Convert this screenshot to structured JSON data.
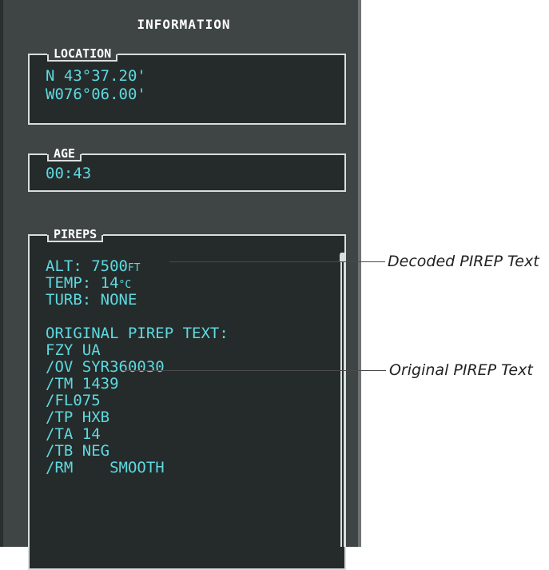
{
  "panel": {
    "title": "INFORMATION"
  },
  "location": {
    "label": "LOCATION",
    "latitude": "N 43°37.20'",
    "longitude": "W076°06.00'"
  },
  "age": {
    "label": "AGE",
    "value": "00:43"
  },
  "pireps": {
    "label": "PIREPS",
    "decoded": {
      "alt_prefix": "ALT: 7500",
      "alt_unit": "FT",
      "temp_prefix": "TEMP: 14",
      "temp_unit": "°C",
      "turb": "TURB: NONE"
    },
    "original_header": "ORIGINAL PIREP TEXT:",
    "original_lines": [
      "FZY UA",
      "/OV SYR360030",
      "/TM 1439",
      "/FL075",
      "/TP HXB",
      "/TA 14",
      "/TB NEG",
      "/RM    SMOOTH"
    ]
  },
  "callouts": {
    "decoded": "Decoded PIREP Text",
    "original": "Original PIREP Text"
  },
  "colors": {
    "panel_bg": "#3f4444",
    "box_bg": "#252b2b",
    "text_cyan": "#5ed9e0",
    "text_white": "#ffffff"
  }
}
